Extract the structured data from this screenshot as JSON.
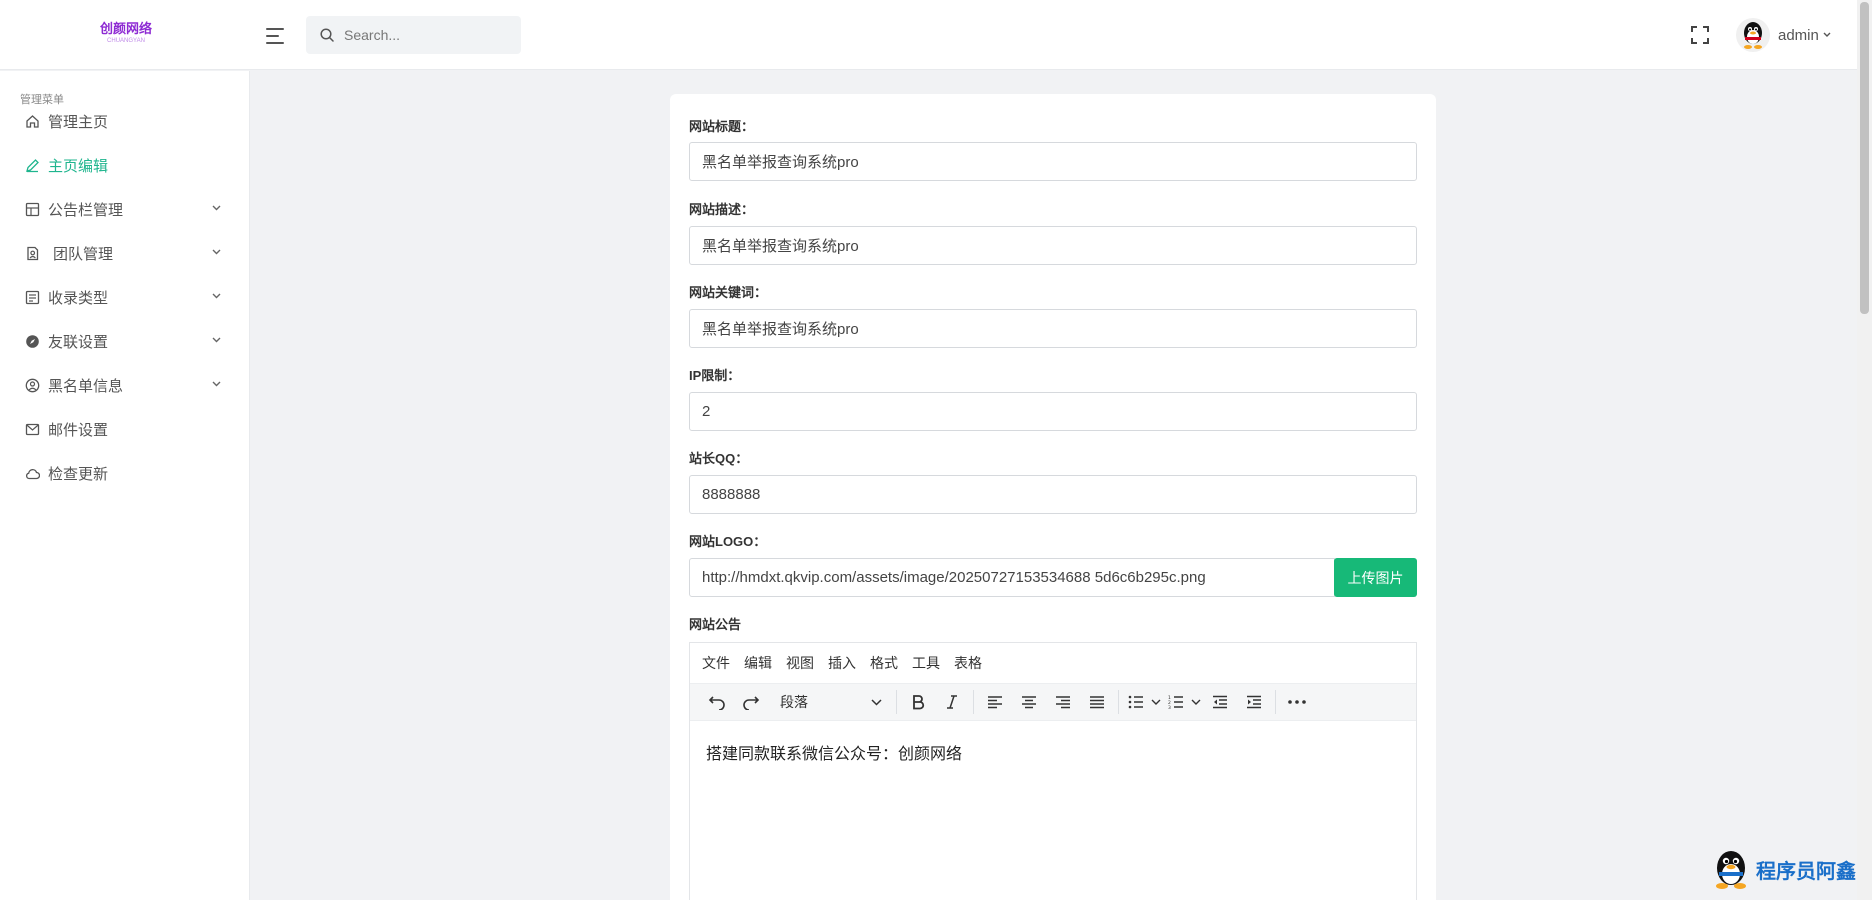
{
  "header": {
    "logo_text": "创颜网络",
    "logo_sub": "CHUANGYAN",
    "search_placeholder": "Search...",
    "username": "admin"
  },
  "sidebar": {
    "title": "管理菜单",
    "items": [
      {
        "label": "管理主页",
        "icon": "home-icon",
        "has_children": false,
        "active": false
      },
      {
        "label": "主页编辑",
        "icon": "edit-icon",
        "has_children": false,
        "active": true
      },
      {
        "label": "公告栏管理",
        "icon": "table-icon",
        "has_children": true,
        "active": false
      },
      {
        "label": "团队管理",
        "icon": "contact-icon",
        "has_children": true,
        "active": false
      },
      {
        "label": "收录类型",
        "icon": "list-icon",
        "has_children": true,
        "active": false
      },
      {
        "label": "友联设置",
        "icon": "compass-icon",
        "has_children": true,
        "active": false
      },
      {
        "label": "黑名单信息",
        "icon": "user-pin-icon",
        "has_children": true,
        "active": false
      },
      {
        "label": "邮件设置",
        "icon": "mail-icon",
        "has_children": false,
        "active": false
      },
      {
        "label": "检查更新",
        "icon": "cloud-icon",
        "has_children": false,
        "active": false
      }
    ]
  },
  "form": {
    "fields": [
      {
        "label": "网站标题：",
        "value": "黑名单举报查询系统pro"
      },
      {
        "label": "网站描述：",
        "value": "黑名单举报查询系统pro"
      },
      {
        "label": "网站关键词：",
        "value": "黑名单举报查询系统pro"
      },
      {
        "label": "IP限制：",
        "value": "2"
      },
      {
        "label": "站长QQ：",
        "value": "8888888"
      }
    ],
    "logo": {
      "label": "网站LOGO：",
      "value": "http://hmdxt.qkvip.com/assets/image/20250727153534688 5d6c6b295c.png",
      "upload_label": "上传图片"
    },
    "notice": {
      "label": "网站公告",
      "menubar": [
        "文件",
        "编辑",
        "视图",
        "插入",
        "格式",
        "工具",
        "表格"
      ],
      "block_format": "段落",
      "content": "搭建同款联系微信公众号：创颜网络"
    }
  },
  "watermark": {
    "text": "程序员阿鑫"
  },
  "colors": {
    "accent": "#1fb58e",
    "upload_button": "#17b978",
    "logo": "#8e2bd3"
  }
}
